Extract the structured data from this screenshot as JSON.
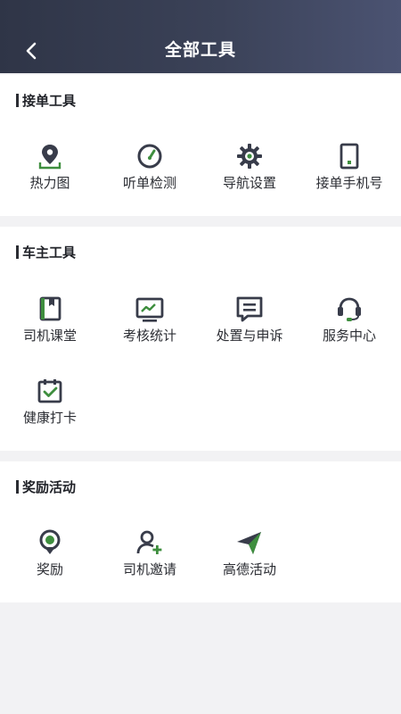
{
  "header": {
    "title": "全部工具",
    "back_icon": "chevron-left-icon"
  },
  "colors": {
    "accent": "#3e8e3e",
    "icon_dark": "#383c4a",
    "header_start": "#2f3547",
    "header_end": "#4b5372"
  },
  "sections": [
    {
      "title": "接单工具",
      "items": [
        {
          "label": "热力图",
          "icon": "map-pin-icon"
        },
        {
          "label": "听单检测",
          "icon": "gauge-icon"
        },
        {
          "label": "导航设置",
          "icon": "gear-icon"
        },
        {
          "label": "接单手机号",
          "icon": "phone-icon"
        }
      ]
    },
    {
      "title": "车主工具",
      "items": [
        {
          "label": "司机课堂",
          "icon": "book-icon"
        },
        {
          "label": "考核统计",
          "icon": "chart-icon"
        },
        {
          "label": "处置与申诉",
          "icon": "message-icon"
        },
        {
          "label": "服务中心",
          "icon": "headset-icon"
        },
        {
          "label": "健康打卡",
          "icon": "calendar-check-icon"
        }
      ]
    },
    {
      "title": "奖励活动",
      "items": [
        {
          "label": "奖励",
          "icon": "medal-icon"
        },
        {
          "label": "司机邀请",
          "icon": "add-user-icon"
        },
        {
          "label": "高德活动",
          "icon": "paper-plane-icon"
        }
      ]
    }
  ]
}
